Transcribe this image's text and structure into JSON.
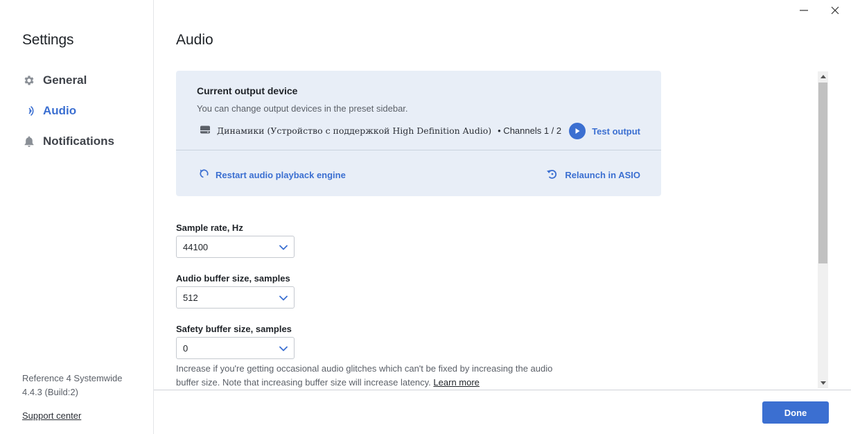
{
  "window": {
    "minimize_icon": "minimize-icon",
    "close_icon": "close-icon"
  },
  "sidebar": {
    "title": "Settings",
    "items": [
      {
        "label": "General",
        "icon": "gear-icon",
        "active": false
      },
      {
        "label": "Audio",
        "icon": "audio-icon",
        "active": true
      },
      {
        "label": "Notifications",
        "icon": "bell-icon",
        "active": false
      }
    ],
    "app_name": "Reference 4 Systemwide",
    "app_version": "4.4.3 (Build:2)",
    "support_link": "Support center"
  },
  "main": {
    "title": "Audio",
    "output_card": {
      "title": "Current output device",
      "subtitle": "You can change output devices in the preset sidebar.",
      "device_name": "Динамики (Устройство с поддержкой High Definition Audio)",
      "channels": "• Channels 1 / 2",
      "test_output_label": "Test output",
      "restart_label": "Restart audio playback engine",
      "relaunch_label": "Relaunch in ASIO"
    },
    "sample_rate": {
      "label": "Sample rate, Hz",
      "value": "44100"
    },
    "buffer_size": {
      "label": "Audio buffer size, samples",
      "value": "512"
    },
    "safety_buffer": {
      "label": "Safety buffer size, samples",
      "value": "0"
    },
    "help_text": "Increase if you're getting occasional audio glitches which can't be fixed by increasing the audio buffer size. Note that increasing buffer size will increase latency.",
    "learn_more": "Learn more"
  },
  "footer": {
    "done_label": "Done"
  },
  "colors": {
    "accent": "#3b6fd1",
    "card_bg": "#e8eef7"
  }
}
